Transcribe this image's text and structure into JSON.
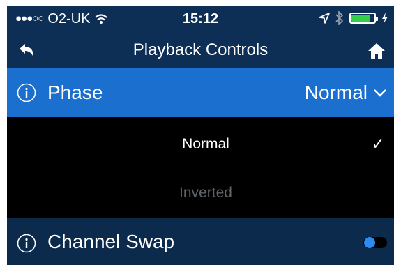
{
  "status_bar": {
    "carrier": "O2-UK",
    "signal_dots": "●●●○○",
    "time": "15:12",
    "battery_level": 0.8,
    "battery_color": "#35d04b"
  },
  "nav": {
    "title": "Playback Controls",
    "back_icon": "back-arrow-icon",
    "home_icon": "home-icon"
  },
  "phase": {
    "label": "Phase",
    "value": "Normal",
    "accent": "#1b6fcf"
  },
  "dropdown": {
    "options": [
      {
        "label": "Normal",
        "selected": true,
        "check": "✓"
      },
      {
        "label": "Inverted",
        "selected": false
      }
    ]
  },
  "channel_swap": {
    "label": "Channel Swap",
    "enabled": false
  }
}
